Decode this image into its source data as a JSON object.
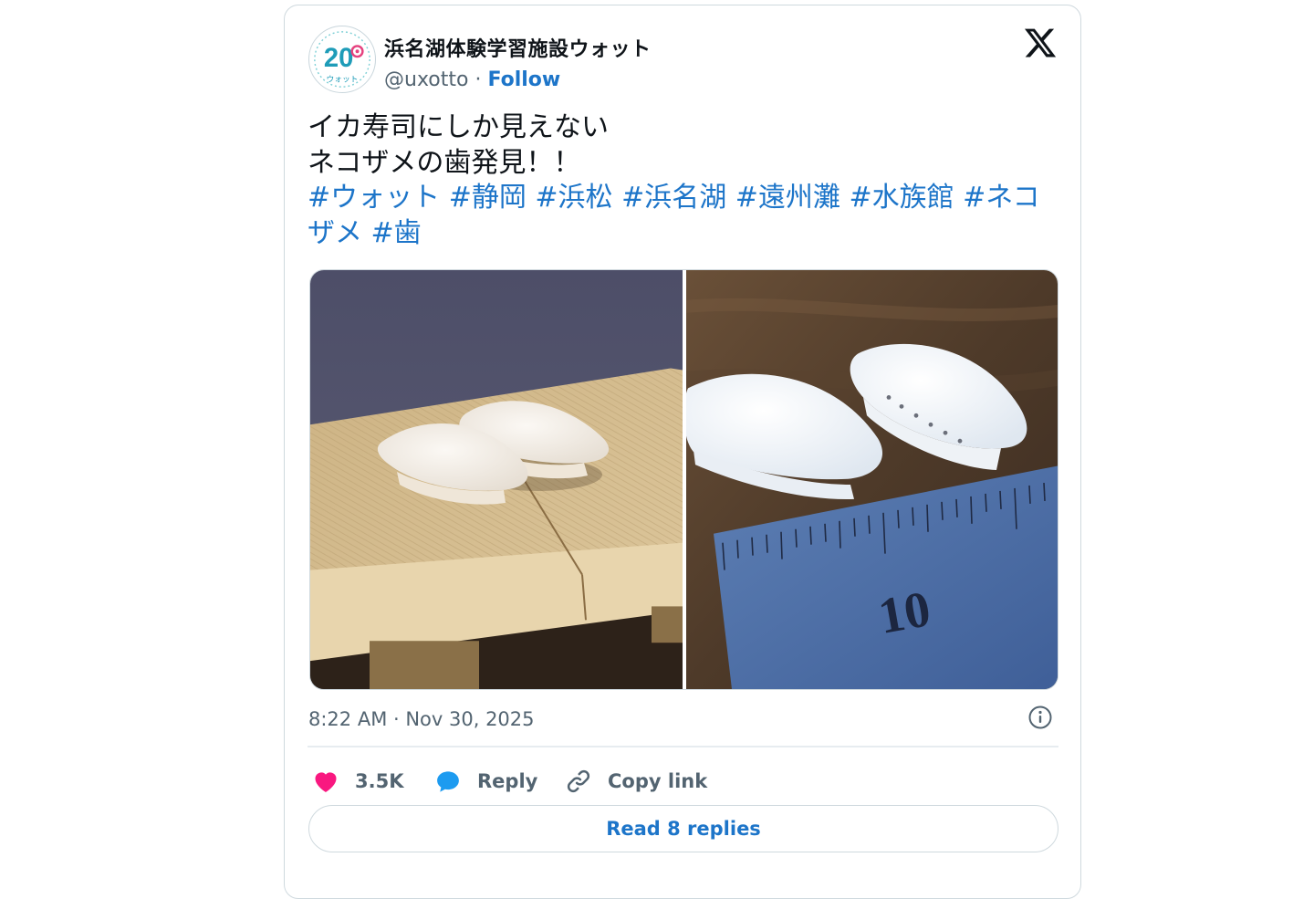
{
  "author": {
    "display_name": "浜名湖体験学習施設ウォット",
    "handle": "@uxotto",
    "separator": " · ",
    "follow_label": "Follow",
    "avatar_text": "20",
    "avatar_subtext": "ウォット"
  },
  "tweet": {
    "lines": [
      "イカ寿司にしか見えない",
      "ネコザメの歯発見！！"
    ],
    "hashtags": [
      "#ウォット",
      "#静岡",
      "#浜松",
      "#浜名湖",
      "#遠州灘",
      "#水族館",
      "#ネコザメ",
      "#歯"
    ]
  },
  "media": {
    "photos": [
      {
        "icon": "sushi-photo-on-wooden-stand"
      },
      {
        "icon": "shark-teeth-with-ruler-photo",
        "ruler_label": "10"
      }
    ]
  },
  "timestamp": "8:22 AM · Nov 30, 2025",
  "actions": {
    "like_count": "3.5K",
    "reply_label": "Reply",
    "copy_label": "Copy link"
  },
  "read_replies_label": "Read 8 replies",
  "colors": {
    "accent": "#1d75c9",
    "like": "#f91880",
    "reply_icon": "#1d9bf0",
    "muted_text": "#536471",
    "border": "#cfd9de"
  }
}
